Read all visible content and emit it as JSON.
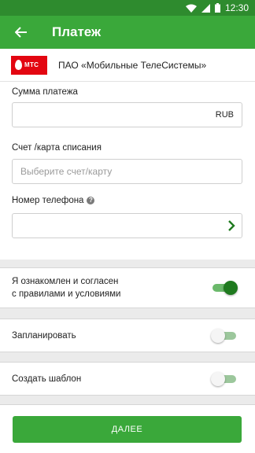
{
  "status_bar": {
    "time": "12:30"
  },
  "appbar": {
    "title": "Платеж",
    "back_icon": "arrow-left-icon"
  },
  "provider": {
    "logo_text": "МТС",
    "name": "ПАО «Мобильные ТелеСистемы»",
    "logo_color": "#e30611"
  },
  "form": {
    "amount_label": "Сумма платежа",
    "amount_value": "",
    "currency": "RUB",
    "account_label": "Счет /карта списания",
    "account_placeholder": "Выберите счет/карту",
    "phone_label": "Номер телефона",
    "phone_value": ""
  },
  "toggles": {
    "agree": {
      "label_line1": "Я ознакомлен и согласен",
      "label_line2": "с правилами и условиями",
      "on": true
    },
    "schedule": {
      "label": "Запланировать",
      "on": false
    },
    "template": {
      "label": "Создать шаблон",
      "on": false
    }
  },
  "next_button": {
    "label": "ДАЛЕЕ"
  },
  "colors": {
    "primary": "#3aa83a",
    "status_bar": "#2e8b2e",
    "switch_on": "#1f7a1f"
  }
}
